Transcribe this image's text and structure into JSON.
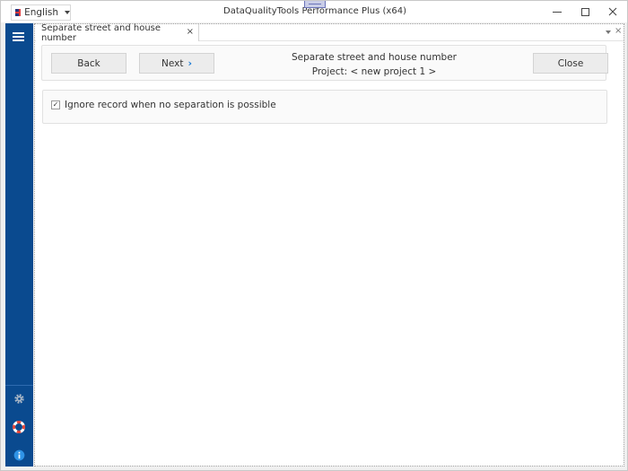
{
  "titlebar": {
    "language": "English",
    "app_title": "DataQualityTools Performance Plus (x64)",
    "minimize_icon": "minimize-icon",
    "maximize_icon": "maximize-icon",
    "close_icon": "close-icon"
  },
  "sidebar": {
    "menu_icon": "hamburger-icon",
    "bottom_icons": [
      "gear-icon",
      "lifebuoy-icon",
      "info-icon"
    ]
  },
  "tabs": [
    {
      "label": "Separate street and house number",
      "close": "×",
      "active": true
    }
  ],
  "tabstrip": {
    "menu_icon": "chevron-down-icon",
    "close_glyph": "×"
  },
  "wizard": {
    "back_label": "Back",
    "next_label": "Next",
    "next_glyph": "›",
    "close_label": "Close",
    "title": "Separate street and house number",
    "project": "Project: < new project 1 >"
  },
  "options": {
    "ignore_record": {
      "label": "Ignore record when no separation is possible",
      "checked": true,
      "check_glyph": "✓"
    }
  },
  "colors": {
    "sidebar": "#0a4a8f",
    "accent": "#1c7bd4",
    "help_red": "#e0463a"
  }
}
